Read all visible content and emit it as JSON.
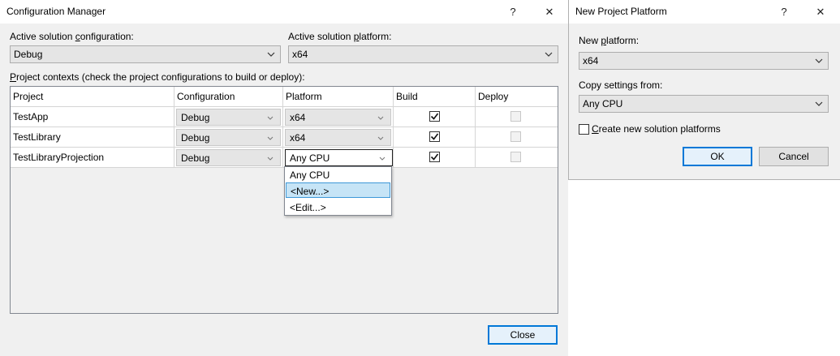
{
  "config_manager": {
    "title": "Configuration Manager",
    "help_glyph": "?",
    "close_glyph": "✕",
    "active_config_label_pre": "Active solution ",
    "active_config_label_u": "c",
    "active_config_label_post": "onfiguration:",
    "active_config_value": "Debug",
    "active_platform_label_pre": "Active solution ",
    "active_platform_label_u": "p",
    "active_platform_label_post": "latform:",
    "active_platform_value": "x64",
    "contexts_label_u": "P",
    "contexts_label_post": "roject contexts (check the project configurations to build or deploy):",
    "columns": [
      "Project",
      "Configuration",
      "Platform",
      "Build",
      "Deploy"
    ],
    "rows": [
      {
        "project": "TestApp",
        "configuration": "Debug",
        "platform": "x64",
        "build": true,
        "deploy": false
      },
      {
        "project": "TestLibrary",
        "configuration": "Debug",
        "platform": "x64",
        "build": true,
        "deploy": false
      },
      {
        "project": "TestLibraryProjection",
        "configuration": "Debug",
        "platform": "Any CPU",
        "build": true,
        "deploy": false
      }
    ],
    "platform_dropdown": [
      "Any CPU",
      "<New...>",
      "<Edit...>"
    ],
    "platform_dropdown_selected": "<New...>",
    "close_button": "Close"
  },
  "new_platform": {
    "title": "New Project Platform",
    "help_glyph": "?",
    "close_glyph": "✕",
    "platform_label_pre": "New ",
    "platform_label_u": "p",
    "platform_label_post": "latform:",
    "platform_value": "x64",
    "copy_label": "Copy settings from:",
    "copy_value": "Any CPU",
    "create_checkbox_u": "C",
    "create_checkbox_post": "reate new solution platforms",
    "create_checked": false,
    "ok_button": "OK",
    "cancel_button": "Cancel"
  },
  "colors": {
    "window_bg": "#f0f0f0",
    "accent": "#0078d7",
    "selection": "#c6e4f6"
  }
}
